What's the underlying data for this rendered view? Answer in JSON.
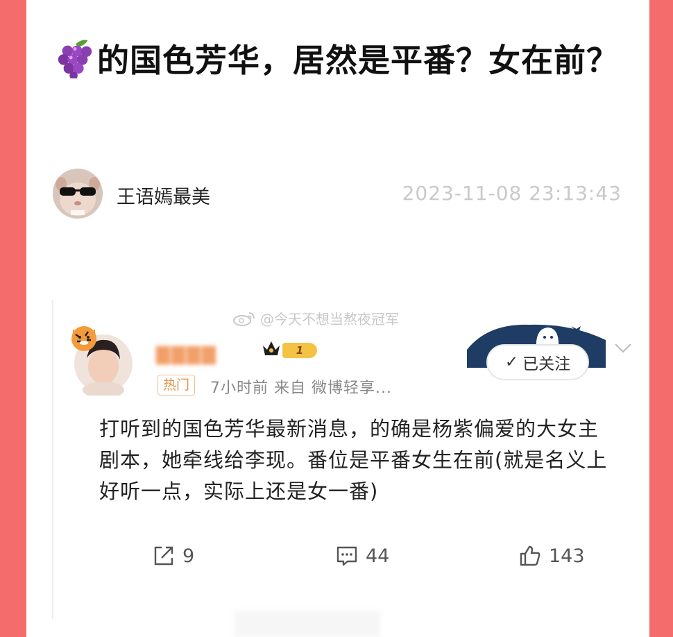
{
  "article": {
    "title": "的国色芳华，居然是平番？女在前？",
    "author": "王语嫣最美",
    "timestamp": "2023-11-08 23:13:43"
  },
  "embedded_post": {
    "watermark": "@今天不想当熬夜冠军",
    "level_badge": "1",
    "hot_tag": "热门",
    "meta": "7小时前  来自 微博轻享...",
    "follow_label": "已关注",
    "follow_check": "✓",
    "body": "打听到的国色芳华最新消息，的确是杨紫偏爱的大女主剧本，她牵线给李现。番位是平番女生在前(就是名义上好听一点，实际上还是女一番)",
    "stats": {
      "reposts": "9",
      "comments": "44",
      "likes": "143"
    }
  },
  "icons": [
    "grape-emoji-icon",
    "crown-icon",
    "ghost-bat-decoration-icon",
    "chevron-down-icon",
    "repost-icon",
    "comment-icon",
    "like-icon",
    "weibo-logo-icon"
  ],
  "colors": {
    "background_border": "#f46c6c",
    "hot_tag": "#e8914a",
    "badge": "#f6c243",
    "timestamp": "#c9c9c9"
  }
}
